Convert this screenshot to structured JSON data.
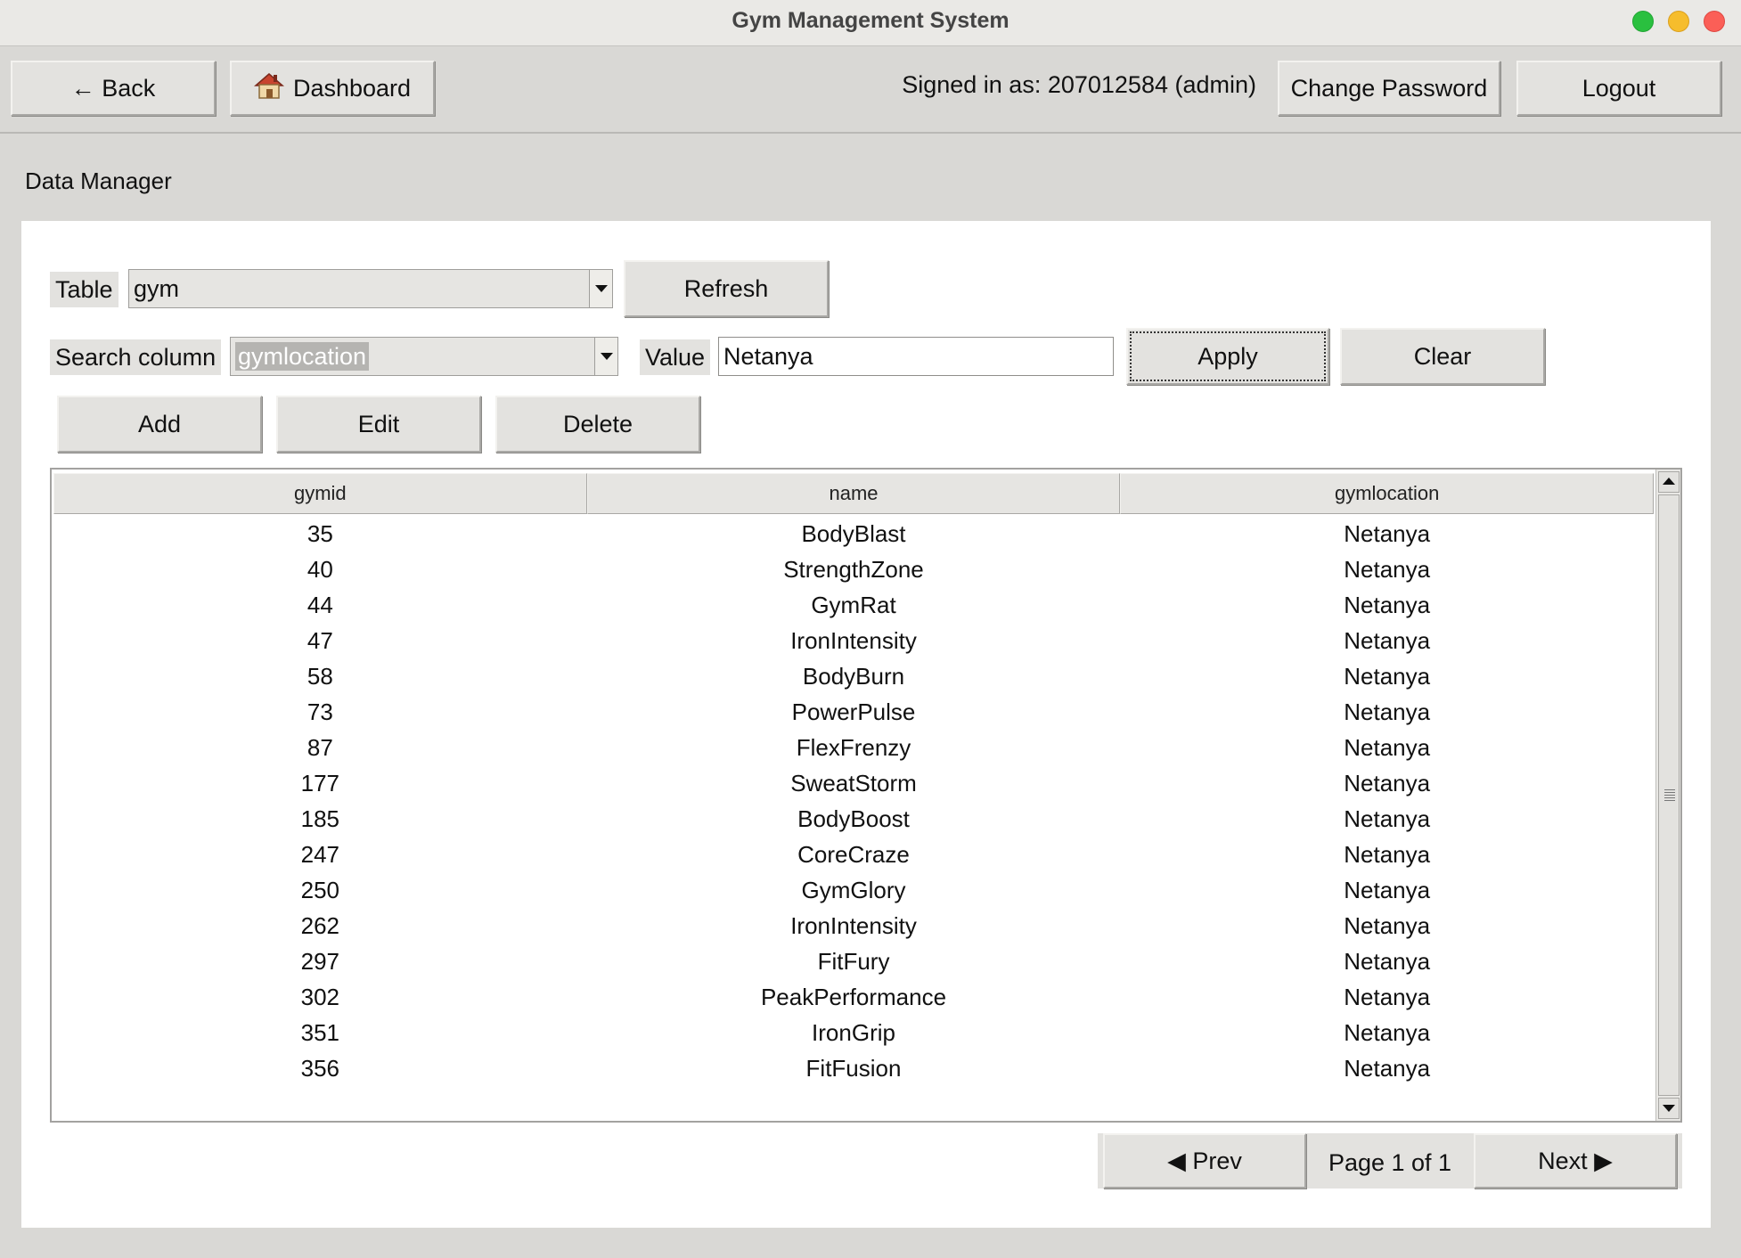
{
  "window": {
    "title": "Gym Management System"
  },
  "toolbar": {
    "back_label": "← Back",
    "dashboard_label": "Dashboard",
    "dashboard_icon": "house-icon",
    "signed_in_text": "Signed in as: 207012584 (admin)",
    "change_password_label": "Change Password",
    "logout_label": "Logout"
  },
  "section": {
    "title": "Data Manager"
  },
  "controls": {
    "table_label": "Table",
    "table_value": "gym",
    "refresh_label": "Refresh",
    "search_column_label": "Search column",
    "search_column_value": "gymlocation",
    "value_label": "Value",
    "value_text": "Netanya",
    "apply_label": "Apply",
    "clear_label": "Clear",
    "add_label": "Add",
    "edit_label": "Edit",
    "delete_label": "Delete"
  },
  "table": {
    "columns": [
      "gymid",
      "name",
      "gymlocation"
    ],
    "rows": [
      [
        "35",
        "BodyBlast",
        "Netanya"
      ],
      [
        "40",
        "StrengthZone",
        "Netanya"
      ],
      [
        "44",
        "GymRat",
        "Netanya"
      ],
      [
        "47",
        "IronIntensity",
        "Netanya"
      ],
      [
        "58",
        "BodyBurn",
        "Netanya"
      ],
      [
        "73",
        "PowerPulse",
        "Netanya"
      ],
      [
        "87",
        "FlexFrenzy",
        "Netanya"
      ],
      [
        "177",
        "SweatStorm",
        "Netanya"
      ],
      [
        "185",
        "BodyBoost",
        "Netanya"
      ],
      [
        "247",
        "CoreCraze",
        "Netanya"
      ],
      [
        "250",
        "GymGlory",
        "Netanya"
      ],
      [
        "262",
        "IronIntensity",
        "Netanya"
      ],
      [
        "297",
        "FitFury",
        "Netanya"
      ],
      [
        "302",
        "PeakPerformance",
        "Netanya"
      ],
      [
        "351",
        "IronGrip",
        "Netanya"
      ],
      [
        "356",
        "FitFusion",
        "Netanya"
      ]
    ]
  },
  "pager": {
    "prev_label": "◀ Prev",
    "page_text": "Page 1 of 1",
    "next_label": "Next ▶"
  }
}
